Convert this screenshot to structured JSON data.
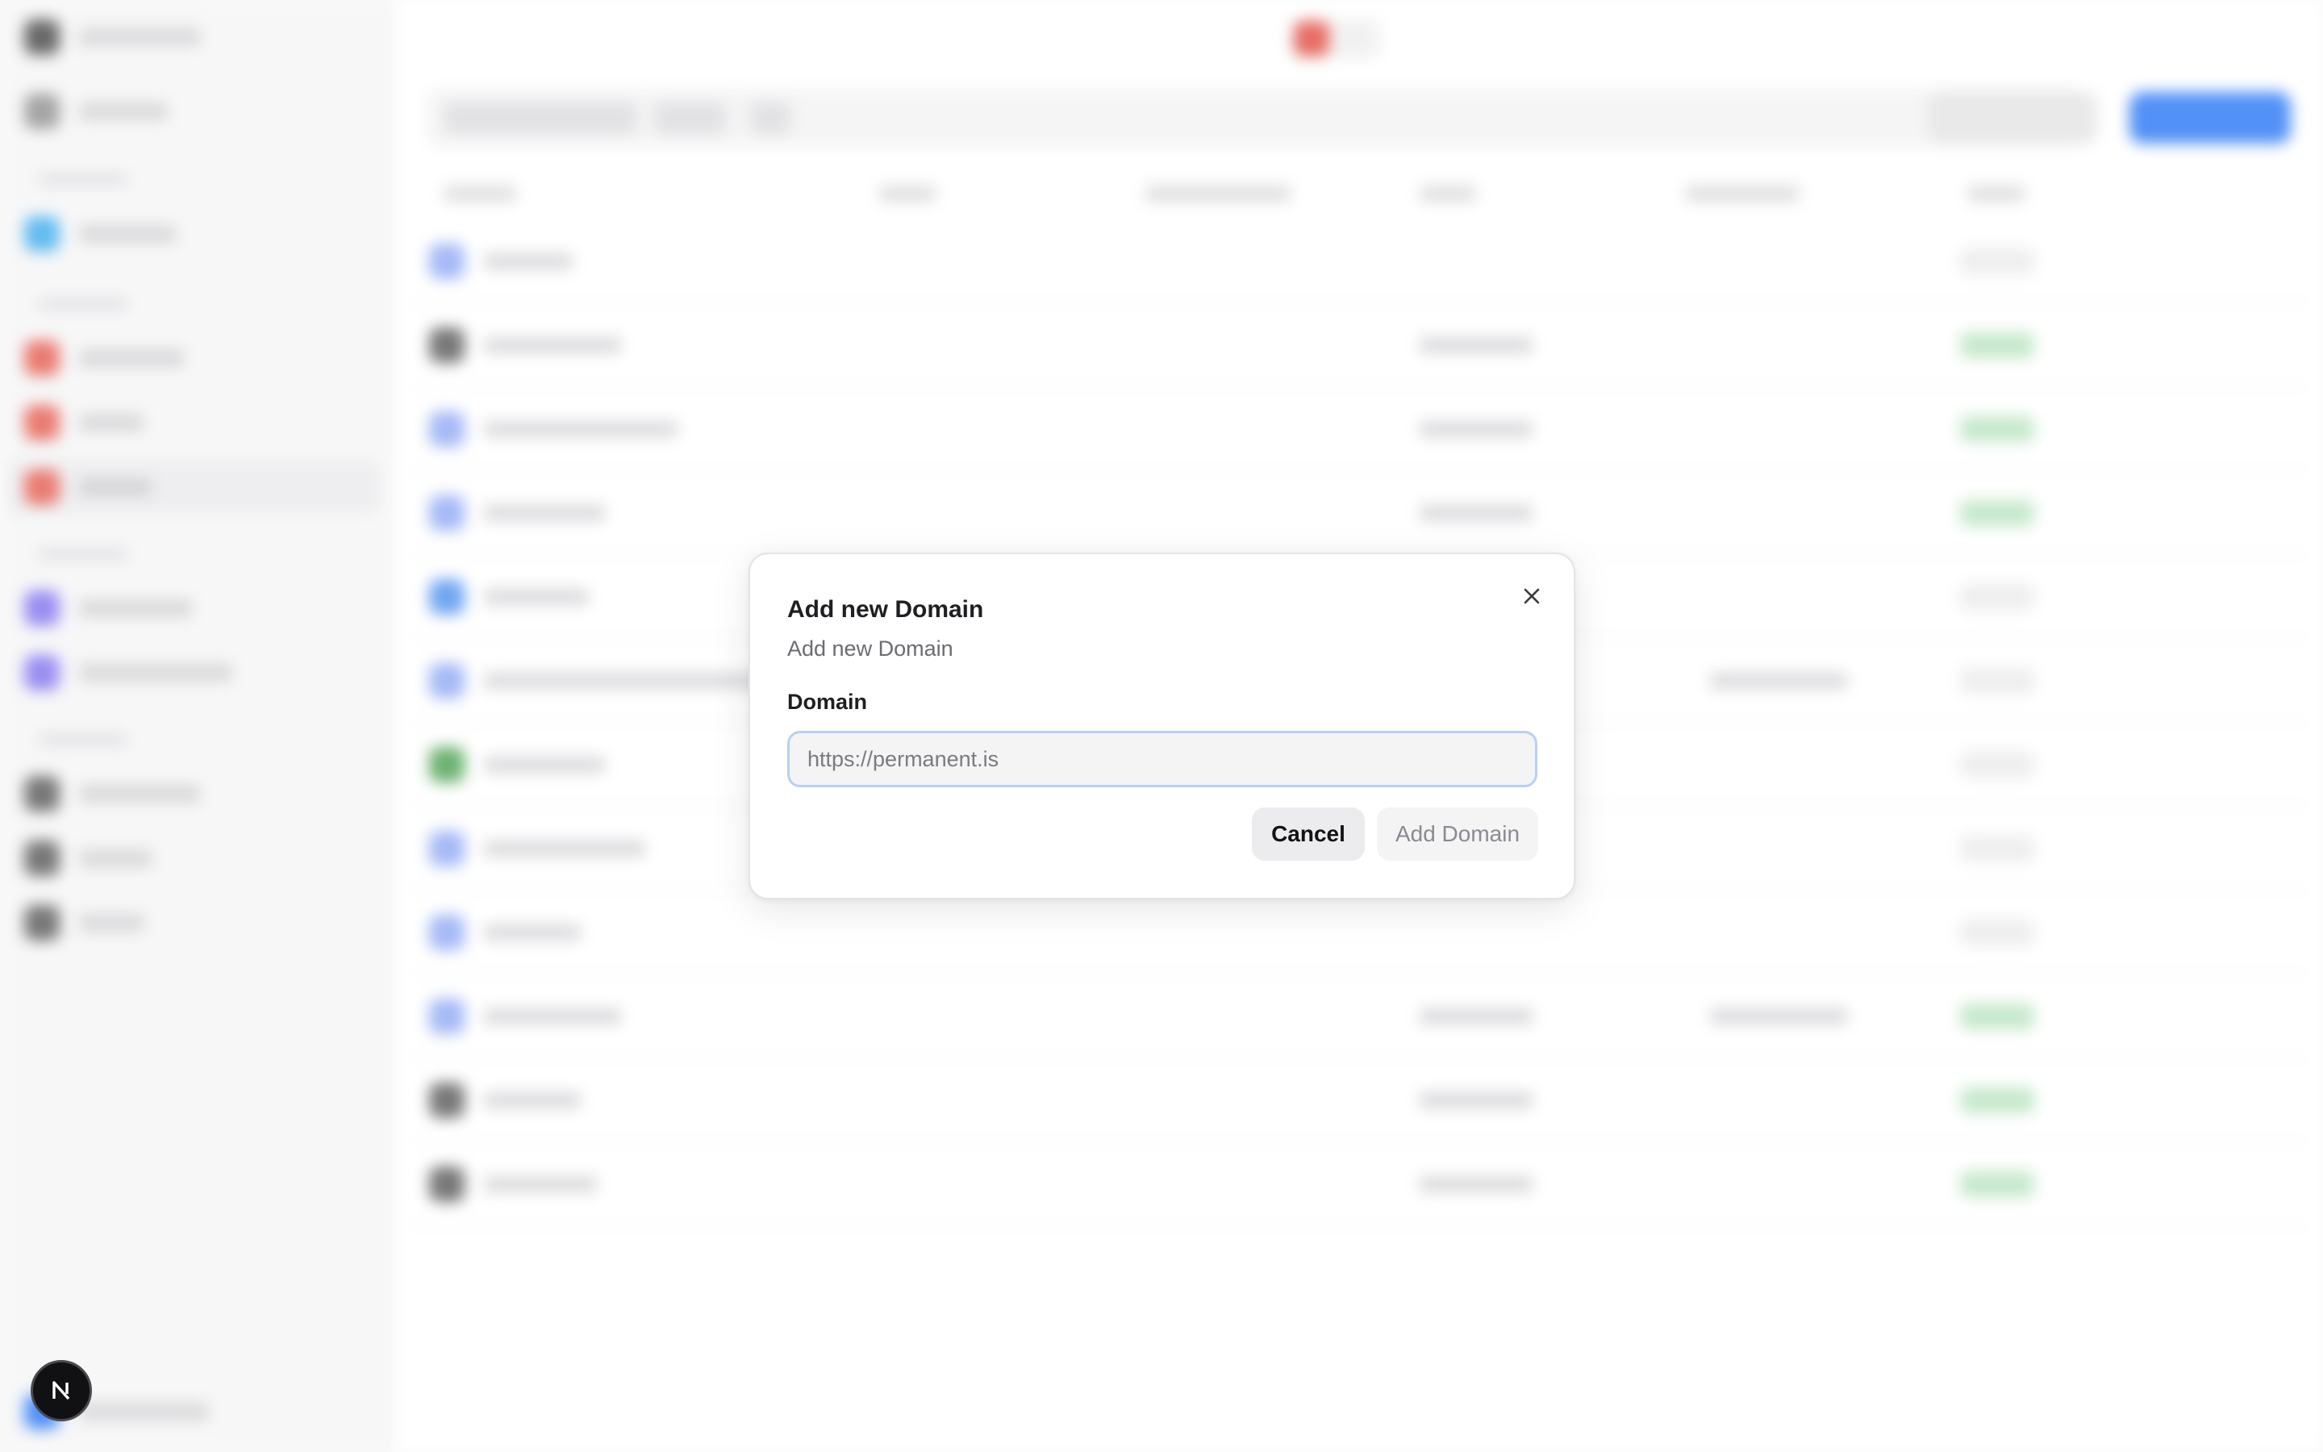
{
  "modal": {
    "title": "Add new Domain",
    "description": "Add new Domain",
    "field_label": "Domain",
    "input": {
      "value": "",
      "placeholder": "https://permanent.is"
    },
    "cancel_label": "Cancel",
    "submit_label": "Add Domain",
    "close_icon": "close-icon"
  },
  "floating_badge": {
    "icon": "nextjs-logo-icon"
  },
  "colors": {
    "primary_blue": "#3b82f6",
    "success_green": "#59b86b",
    "danger_red": "#e45a4f",
    "input_focus_ring": "#b8d0f4"
  }
}
